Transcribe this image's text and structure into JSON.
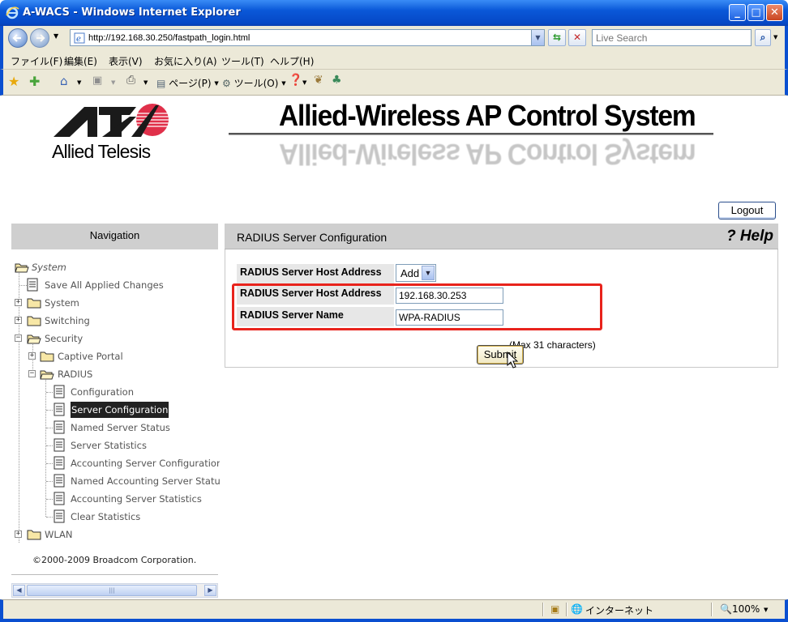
{
  "window": {
    "title": "A-WACS - Windows Internet Explorer"
  },
  "address": {
    "url": "http://192.168.30.250/fastpath_login.html"
  },
  "search": {
    "placeholder": "Live Search"
  },
  "menu": {
    "items": [
      "ファイル(F)",
      "編集(E)",
      "表示(V)",
      "お気に入り(A)",
      "ツール(T)",
      "ヘルプ(H)"
    ]
  },
  "toolbar": {
    "page_label": "ページ(P)",
    "tools_label": "ツール(O)"
  },
  "page": {
    "brand": "Allied Telesis",
    "app_title": "Allied-Wireless AP Control System",
    "logout_label": "Logout",
    "nav_header": "Navigation",
    "content_title": "RADIUS Server Configuration",
    "help_label": "? Help",
    "copyright": "©2000-2009 Broadcom Corporation."
  },
  "form": {
    "select_label": "RADIUS Server Host Address",
    "select_value": "Add",
    "host_label": "RADIUS Server Host Address",
    "host_value": "192.168.30.253",
    "name_label": "RADIUS Server Name",
    "name_value": "WPA-RADIUS",
    "name_hint": "(Max 31 characters)",
    "submit_label": "Submit"
  },
  "tree": {
    "root": "System",
    "save": "Save All Applied Changes",
    "system": "System",
    "switching": "Switching",
    "security": "Security",
    "captive": "Captive Portal",
    "radius": "RADIUS",
    "radius_items": [
      "Configuration",
      "Server Configuration",
      "Named Server Status",
      "Server Statistics",
      "Accounting Server Configuration",
      "Named Accounting Server Status",
      "Accounting Server Statistics",
      "Clear Statistics"
    ],
    "wlan": "WLAN"
  },
  "status": {
    "zone": "インターネット",
    "zoom": "100%"
  }
}
